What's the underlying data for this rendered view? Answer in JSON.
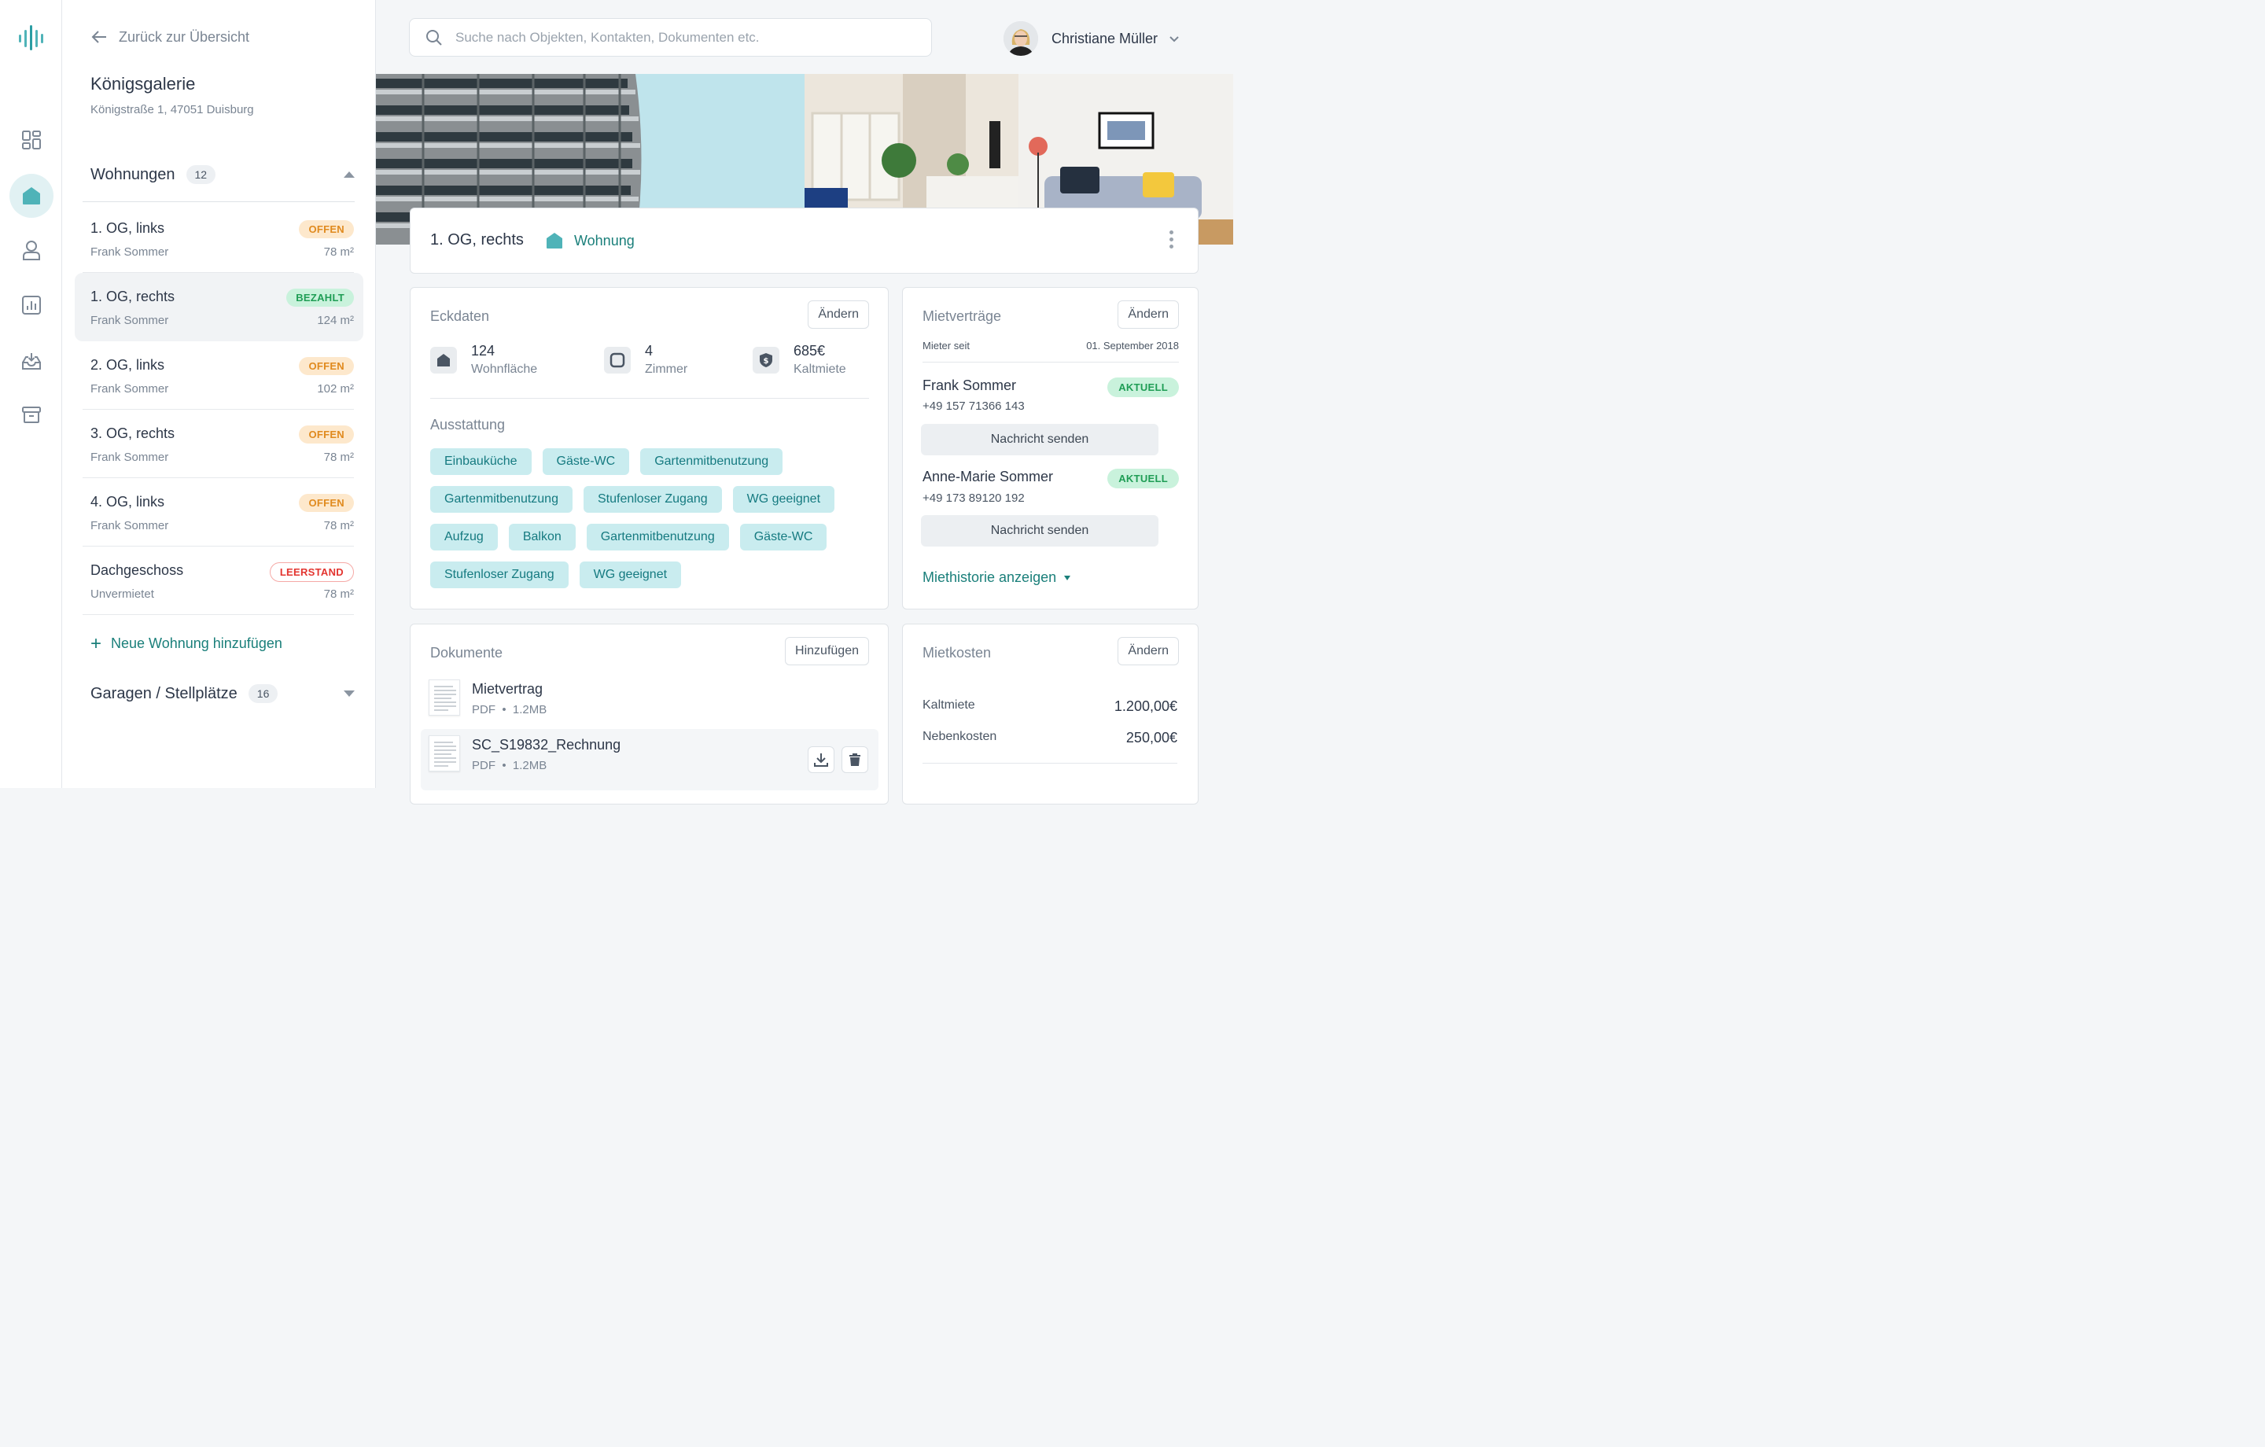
{
  "app": {
    "nav": [
      {
        "icon": "dashboard-icon",
        "active": false
      },
      {
        "icon": "home-icon",
        "active": true
      },
      {
        "icon": "user-icon",
        "active": false
      },
      {
        "icon": "chart-icon",
        "active": false
      },
      {
        "icon": "inbox-icon",
        "active": false
      },
      {
        "icon": "archive-icon",
        "active": false
      }
    ],
    "accent": "#1a7f7a",
    "accent_light": "#e1f1f3"
  },
  "panel": {
    "back_label": "Zurück zur Übersicht",
    "property_name": "Königsgalerie",
    "property_address": "Königstraße 1, 47051 Duisburg",
    "apartments_label": "Wohnungen",
    "apartments_count": "12",
    "units": [
      {
        "name": "1. OG, links",
        "status": "OFFEN",
        "tenant": "Frank Sommer",
        "area": "78 m²"
      },
      {
        "name": "1. OG, rechts",
        "status": "BEZAHLT",
        "tenant": "Frank Sommer",
        "area": "124 m²"
      },
      {
        "name": "2. OG, links",
        "status": "OFFEN",
        "tenant": "Frank Sommer",
        "area": "102 m²"
      },
      {
        "name": "3. OG, rechts",
        "status": "OFFEN",
        "tenant": "Frank Sommer",
        "area": "78 m²"
      },
      {
        "name": "4. OG, links",
        "status": "OFFEN",
        "tenant": "Frank Sommer",
        "area": "78 m²"
      },
      {
        "name": "Dachgeschoss",
        "status": "LEERSTAND",
        "tenant": "Unvermietet",
        "area": "78 m²"
      }
    ],
    "add_unit_label": "Neue Wohnung hinzufügen",
    "garages_label": "Garagen / Stellplätze",
    "garages_count": "16"
  },
  "topbar": {
    "search_placeholder": "Suche nach Objekten, Kontakten, Dokumenten etc.",
    "user_name": "Christiane Müller"
  },
  "unit_header": {
    "title": "1. OG, rechts",
    "type_label": "Wohnung"
  },
  "eckdaten": {
    "title": "Eckdaten",
    "edit_label": "Ändern",
    "stats": [
      {
        "value": "124",
        "label": "Wohnfläche",
        "icon": "home-icon"
      },
      {
        "value": "4",
        "label": "Zimmer",
        "icon": "room-icon"
      },
      {
        "value": "685€",
        "label": "Kaltmiete",
        "icon": "money-shield-icon"
      }
    ],
    "features_title": "Ausstattung",
    "features": [
      "Einbauküche",
      "Gäste-WC",
      "Gartenmitbenutzung",
      "Gartenmitbenutzung",
      "Stufenloser Zugang",
      "WG geeignet",
      "Aufzug",
      "Balkon",
      "Gartenmitbenutzung",
      "Gäste-WC",
      "Stufenloser Zugang",
      "WG geeignet"
    ]
  },
  "mietvertraege": {
    "title": "Mietverträge",
    "edit_label": "Ändern",
    "since_label": "Mieter seit",
    "since_value": "01. September 2018",
    "tenants": [
      {
        "name": "Frank Sommer",
        "phone": "+49 157 71366 143",
        "status": "AKTUELL",
        "action": "Nachricht senden"
      },
      {
        "name": "Anne-Marie Sommer",
        "phone": "+49 173 89120 192",
        "status": "AKTUELL",
        "action": "Nachricht senden"
      }
    ],
    "history_label": "Miethistorie anzeigen"
  },
  "dokumente": {
    "title": "Dokumente",
    "add_label": "Hinzufügen",
    "docs": [
      {
        "name": "Mietvertrag",
        "type": "PDF",
        "size": "1.2MB"
      },
      {
        "name": "SC_S19832_Rechnung",
        "type": "PDF",
        "size": "1.2MB"
      }
    ]
  },
  "mietkosten": {
    "title": "Mietkosten",
    "edit_label": "Ändern",
    "rows": [
      {
        "label": "Kaltmiete",
        "value": "1.200,00€"
      },
      {
        "label": "Nebenkosten",
        "value": "250,00€"
      }
    ]
  }
}
